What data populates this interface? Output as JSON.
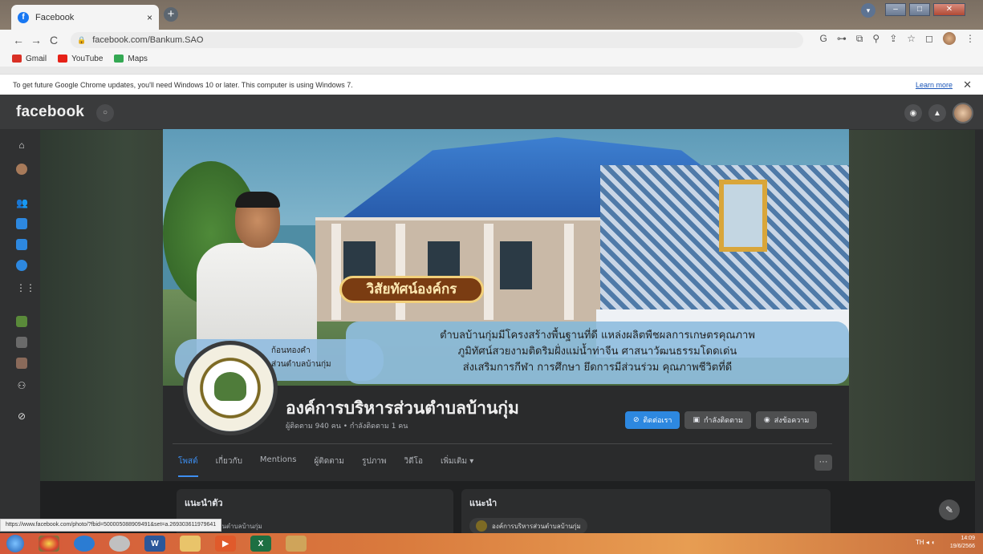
{
  "browser": {
    "tab_title": "Facebook",
    "tab_favicon": "f",
    "tab_close": "×",
    "new_tab": "+",
    "url": "facebook.com/Bankum.SAO",
    "bookmarks": [
      "Gmail",
      "YouTube",
      "Maps"
    ],
    "toolbar_icons": [
      "G",
      "⊶",
      "⧉",
      "⚲",
      "⇪",
      "☆",
      "◻"
    ]
  },
  "infobar": {
    "message": "To get future Google Chrome updates, you'll need Windows 10 or later. This computer is using Windows 7.",
    "learn_more": "Learn more",
    "close": "✕"
  },
  "facebook": {
    "logo": "facebook",
    "cover": {
      "badge": "วิสัยทัศน์องค์กร",
      "vision_lines": [
        "ตำบลบ้านกุ่มมีโครงสร้างพื้นฐานที่ดี แหล่งผลิตพืชผลการเกษตรคุณภาพ",
        "ภูมิทัศน์สวยงามติดริมฝั่งแม่น้ำท่าจีน ศาสนาวัฒนธรรมโดดเด่น",
        "ส่งเสริมการกีฬา การศึกษา ยึดการมีส่วนร่วม คุณภาพชีวิตที่ดี"
      ],
      "slogan_lines": [
        "ก้อนทองคำ",
        "ส่วนตำบลบ้านกุ่ม"
      ]
    },
    "page_name": "องค์การบริหารส่วนตำบลบ้านกุ่ม",
    "page_sub": "ผู้ติดตาม 940 คน • กำลังติดตาม 1 คน",
    "actions": {
      "contact": "ติดต่อเรา",
      "following": "กำลังติดตาม",
      "message": "ส่งข้อความ"
    },
    "tabs": [
      "โพสต์",
      "เกี่ยวกับ",
      "Mentions",
      "ผู้ติดตาม",
      "รูปภาพ",
      "วิดีโอ",
      "เพิ่มเติม ▾"
    ],
    "more_dots": "···",
    "intro_title": "แนะนำตัว",
    "intro_text": "การบริหารส่วนตำบลบ้านกุ่ม",
    "recommend_title": "แนะนำ",
    "recommend_item": "องค์การบริหารส่วนตำบลบ้านกุ่ม"
  },
  "status_url": "https://www.facebook.com/photo/?fbid=500005088909491&set=a.269303611979641",
  "taskbar": {
    "tray": "TH  ◂  ◖",
    "time": "14:09",
    "date": "19/6/2566"
  },
  "colors": {
    "fb_blue": "#2d88e0",
    "fb_dark": "#2a2b2c",
    "taskbar": "#d97a3d"
  }
}
